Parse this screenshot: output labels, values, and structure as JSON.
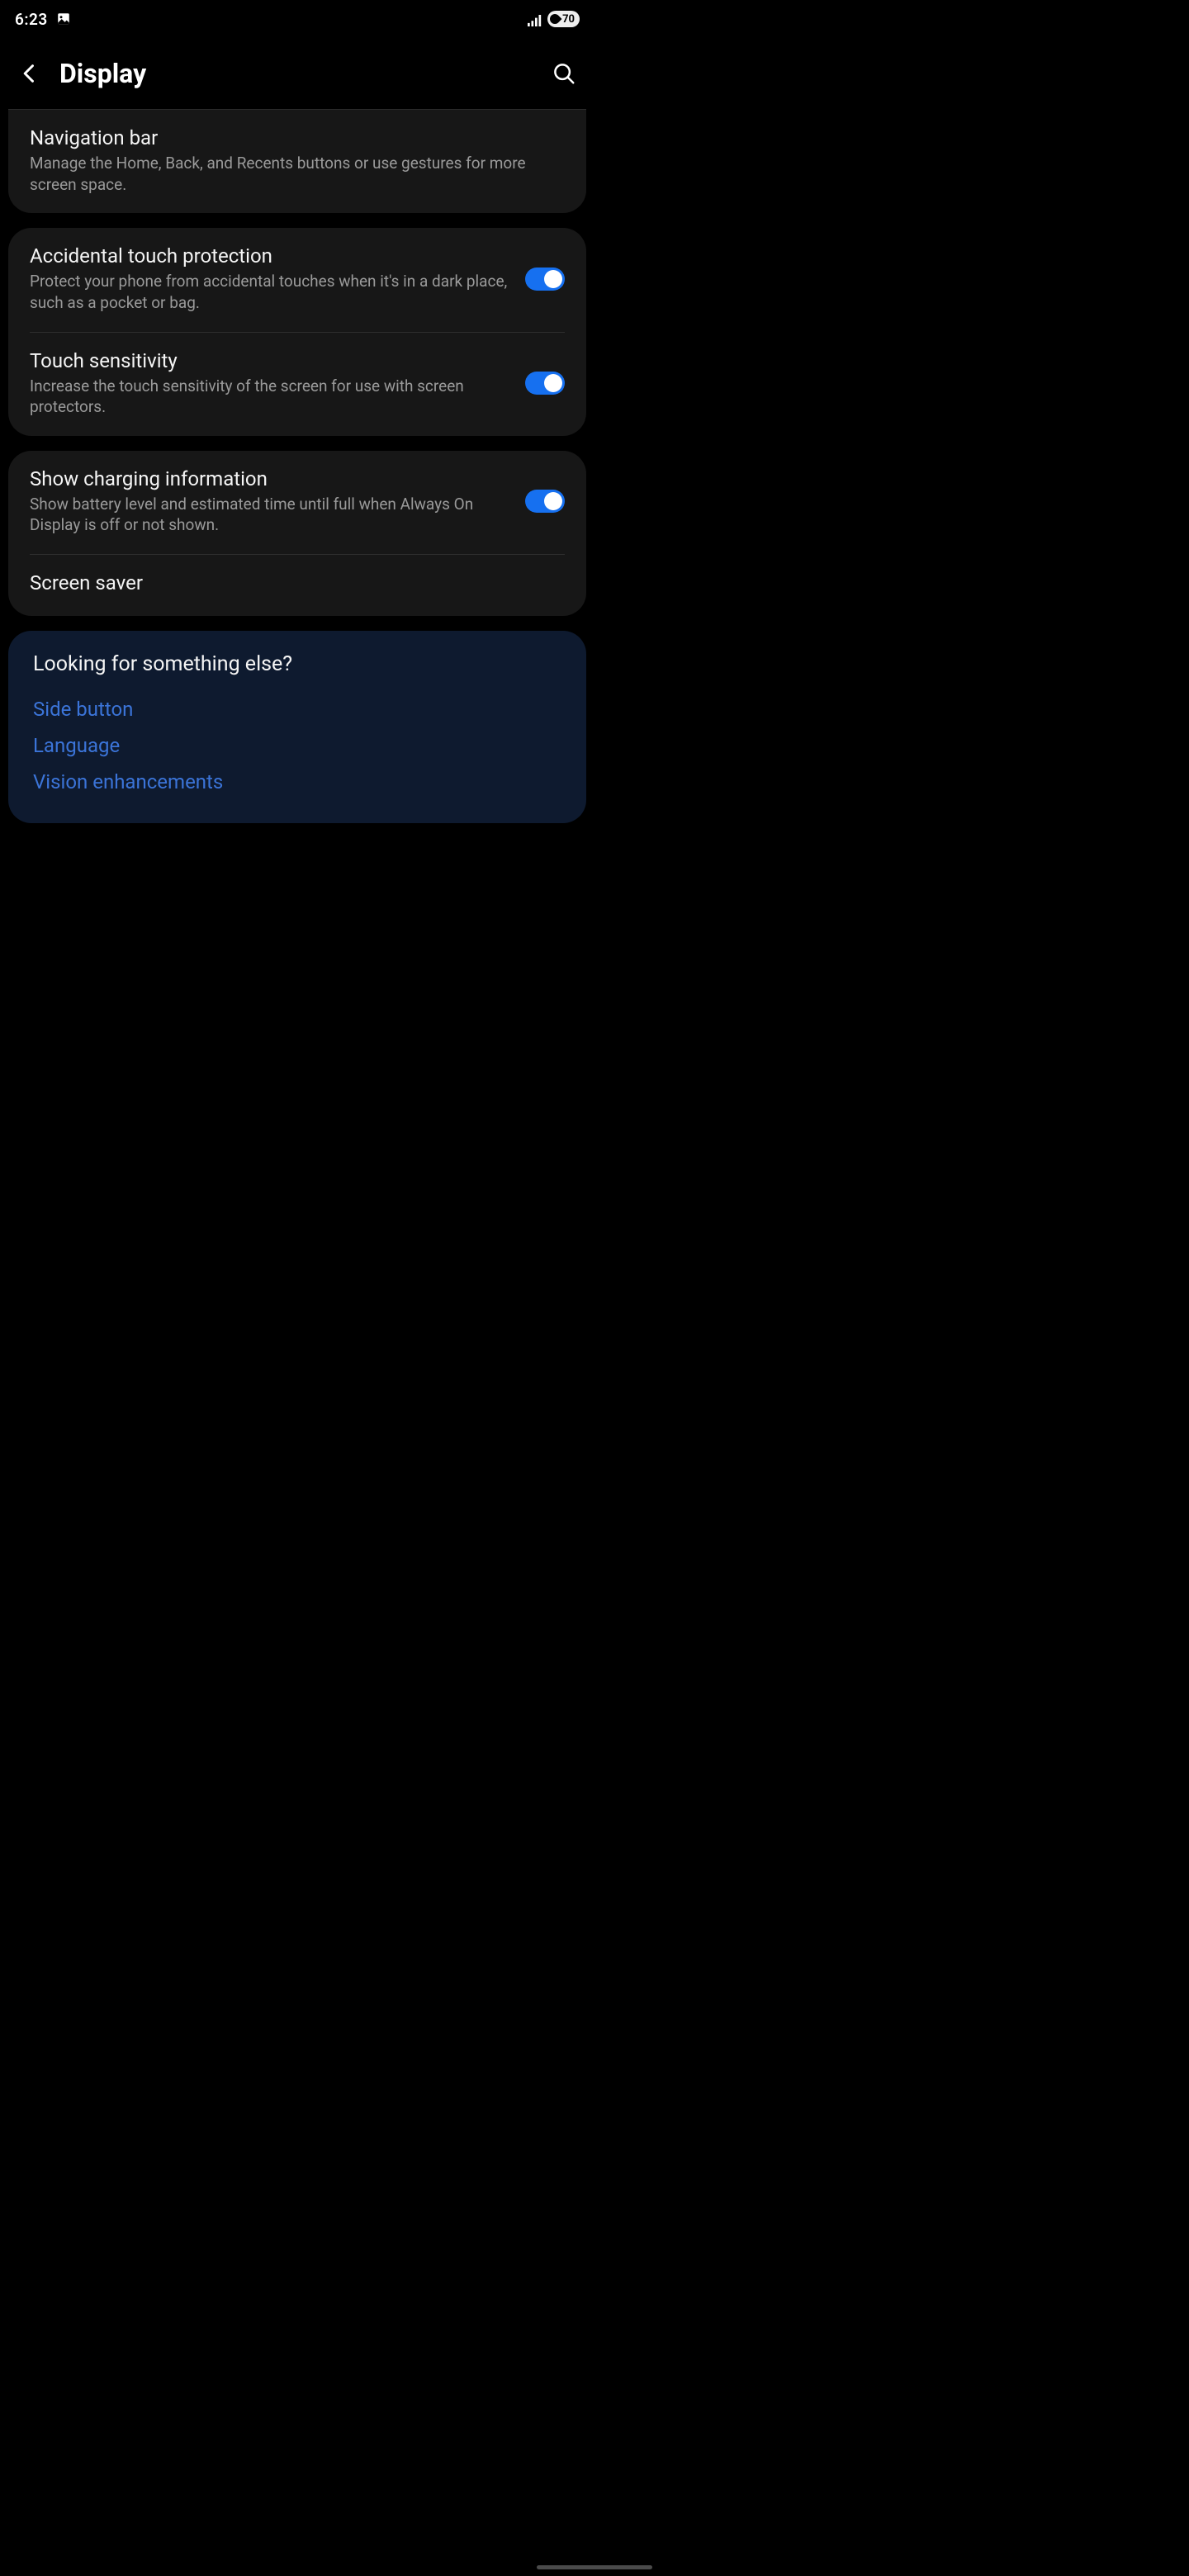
{
  "status": {
    "time": "6:23",
    "battery": "70"
  },
  "header": {
    "title": "Display"
  },
  "sections": [
    {
      "items": [
        {
          "title": "Navigation bar",
          "subtitle": "Manage the Home, Back, and Recents buttons or use gestures for more screen space.",
          "toggle": null
        }
      ]
    },
    {
      "items": [
        {
          "title": "Accidental touch protection",
          "subtitle": "Protect your phone from accidental touches when it's in a dark place, such as a pocket or bag.",
          "toggle": true
        },
        {
          "title": "Touch sensitivity",
          "subtitle": "Increase the touch sensitivity of the screen for use with screen protectors.",
          "toggle": true
        }
      ]
    },
    {
      "items": [
        {
          "title": "Show charging information",
          "subtitle": "Show battery level and estimated time until full when Always On Display is off or not shown.",
          "toggle": true
        },
        {
          "title": "Screen saver",
          "subtitle": null,
          "toggle": null
        }
      ]
    }
  ],
  "suggestions": {
    "title": "Looking for something else?",
    "links": [
      "Side button",
      "Language",
      "Vision enhancements"
    ]
  }
}
